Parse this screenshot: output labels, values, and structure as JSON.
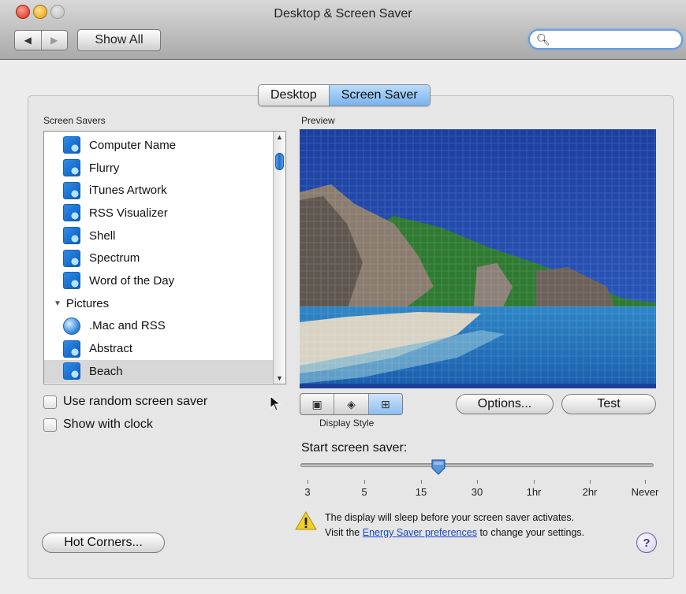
{
  "window": {
    "title": "Desktop & Screen Saver",
    "nav_back": "◀",
    "nav_forward": "▶",
    "show_all": "Show All",
    "search_value": ""
  },
  "tabs": [
    {
      "label": "Desktop",
      "active": false
    },
    {
      "label": "Screen Saver",
      "active": true
    }
  ],
  "screen_savers": {
    "label": "Screen Savers",
    "items": [
      {
        "label": "Computer Name",
        "icon": "screensaver-icon"
      },
      {
        "label": "Flurry",
        "icon": "screensaver-icon"
      },
      {
        "label": "iTunes Artwork",
        "icon": "screensaver-icon"
      },
      {
        "label": "RSS Visualizer",
        "icon": "screensaver-icon"
      },
      {
        "label": "Shell",
        "icon": "screensaver-icon"
      },
      {
        "label": "Spectrum",
        "icon": "screensaver-icon"
      },
      {
        "label": "Word of the Day",
        "icon": "screensaver-icon"
      },
      {
        "label": "Pictures",
        "category": true
      },
      {
        "label": ".Mac and RSS",
        "icon": "globe-icon"
      },
      {
        "label": "Abstract",
        "icon": "screensaver-icon"
      },
      {
        "label": "Beach",
        "icon": "screensaver-icon",
        "selected": true
      }
    ]
  },
  "options": {
    "random": "Use random screen saver",
    "clock": "Show with clock",
    "hot_corners": "Hot Corners..."
  },
  "preview": {
    "label": "Preview",
    "display_style_label": "Display Style",
    "options_button": "Options...",
    "test_button": "Test"
  },
  "start": {
    "label": "Start screen saver:",
    "ticks": [
      "3",
      "5",
      "15",
      "30",
      "1hr",
      "2hr",
      "Never"
    ],
    "selected_position_fraction": 0.39
  },
  "warning": {
    "line1": "The display will sleep before your screen saver activates.",
    "line2_prefix": "Visit the",
    "link": "Energy Saver preferences",
    "line2_suffix": "to change your settings."
  },
  "help": "?",
  "colors": {
    "selection": "#d7d7d7",
    "tab_active": "#78b3ee",
    "link": "#1845c8",
    "preview_border": "#1b3f98"
  }
}
